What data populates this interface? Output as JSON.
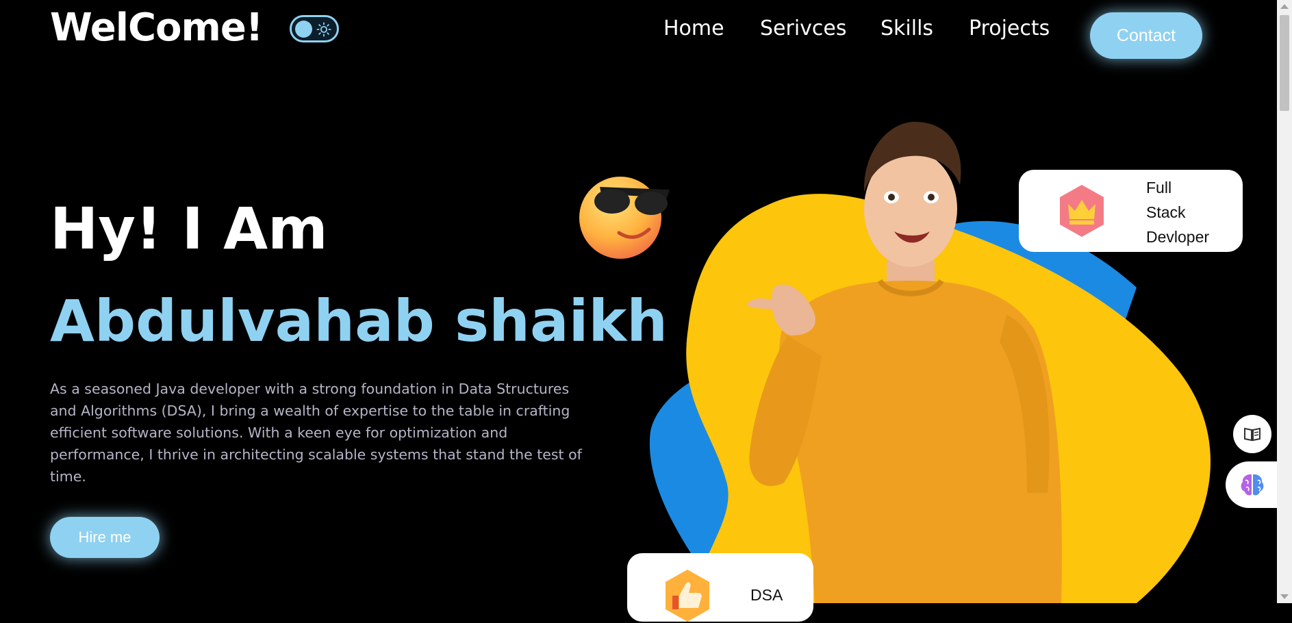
{
  "header": {
    "logo": "WelCome!",
    "nav": [
      "Home",
      "Serivces",
      "Skills",
      "Projects"
    ],
    "contact": "Contact"
  },
  "hero": {
    "greeting": "Hy! I Am",
    "name": "Abdulvahab shaikh",
    "description": "As a seasoned Java developer with a strong foundation in Data Structures and Algorithms (DSA), I bring a wealth of expertise to the table in crafting efficient software solutions. With a keen eye for optimization and performance, I thrive in architecting scalable systems that stand the test of time.",
    "hire": "Hire me"
  },
  "cards": {
    "full_stack": {
      "line1": "Full",
      "line2": "Stack",
      "line3": "Devloper",
      "icon": "crown-icon"
    },
    "dsa": {
      "label": "DSA",
      "icon": "thumbs-up-icon"
    }
  },
  "side_buttons": [
    "book-icon",
    "brain-icon"
  ],
  "colors": {
    "accent": "#8fd1f1",
    "background": "#000000",
    "blob_yellow": "#fdc50c",
    "blob_blue": "#1b8ae3",
    "sweater": "#f0a020"
  }
}
